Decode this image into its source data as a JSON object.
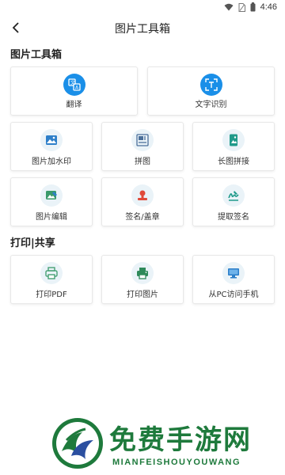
{
  "status_bar": {
    "time": "4:46"
  },
  "header": {
    "title": "图片工具箱"
  },
  "sections": {
    "image_tools": {
      "title": "图片工具箱",
      "big_items": [
        {
          "label": "翻译",
          "icon": "translate-icon"
        },
        {
          "label": "文字识别",
          "icon": "text-recognition-icon"
        }
      ],
      "items": [
        {
          "label": "图片加水印",
          "icon": "image-watermark-icon"
        },
        {
          "label": "拼图",
          "icon": "collage-icon"
        },
        {
          "label": "长图拼接",
          "icon": "long-image-icon"
        },
        {
          "label": "图片编辑",
          "icon": "image-edit-icon"
        },
        {
          "label": "签名/盖章",
          "icon": "signature-stamp-icon"
        },
        {
          "label": "提取签名",
          "icon": "extract-signature-icon"
        }
      ]
    },
    "print_share": {
      "title": "打印|共享",
      "items": [
        {
          "label": "打印PDF",
          "icon": "print-pdf-icon"
        },
        {
          "label": "打印图片",
          "icon": "print-image-icon"
        },
        {
          "label": "从PC访问手机",
          "icon": "pc-access-icon"
        }
      ]
    }
  },
  "watermark": {
    "title": "免费手游网",
    "subtitle": "MIANFEISHOUYOUWANG"
  },
  "colors": {
    "accent": "#1a8fe8",
    "icon_bg": "#eaf3f8",
    "watermark": "#1e7a3c"
  }
}
